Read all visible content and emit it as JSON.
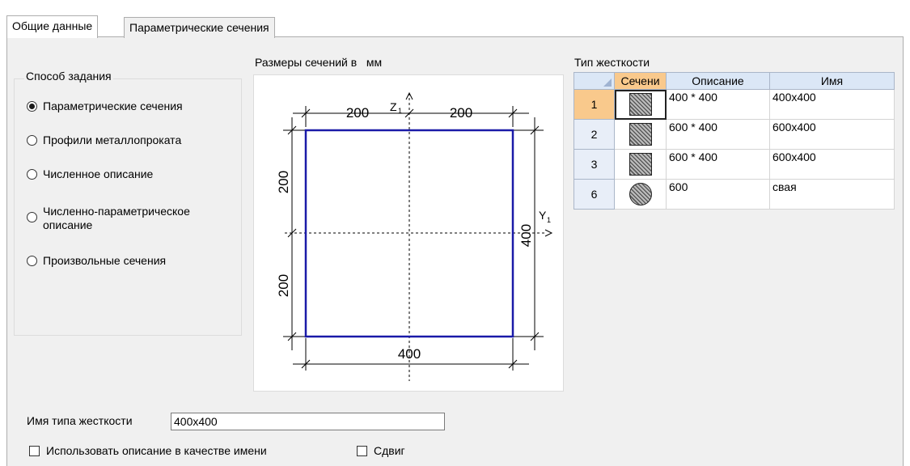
{
  "tabs": [
    {
      "label": "Общие данные",
      "active": true
    },
    {
      "label": "Параметрические сечения",
      "active": false
    }
  ],
  "method_group": {
    "title": "Способ задания",
    "options": [
      {
        "label": "Параметрические сечения",
        "checked": true
      },
      {
        "label": "Профили металлопроката",
        "checked": false
      },
      {
        "label": "Численное описание",
        "checked": false
      },
      {
        "label": "Численно-параметрическое описание",
        "checked": false
      },
      {
        "label": "Произвольные сечения",
        "checked": false
      }
    ]
  },
  "drawing": {
    "title": "Размеры сечений в   мм",
    "dim_top_left": "200",
    "dim_top_right": "200",
    "dim_left_top": "200",
    "dim_left_bottom": "200",
    "dim_right": "400",
    "dim_bottom": "400",
    "axis_z": "Z",
    "axis_y": "Y",
    "axis_subscript": "1",
    "outline_color": "#1a1aa8"
  },
  "grid": {
    "title": "Тип жесткости",
    "columns": [
      "Сечени",
      "Описание",
      "Имя"
    ],
    "rows": [
      {
        "num": "1",
        "shape": "square",
        "description": "400 * 400",
        "name": "400x400",
        "selected": true
      },
      {
        "num": "2",
        "shape": "square",
        "description": "600 * 400",
        "name": "600x400",
        "selected": false
      },
      {
        "num": "3",
        "shape": "square",
        "description": "600 * 400",
        "name": "600x400",
        "selected": false
      },
      {
        "num": "6",
        "shape": "circle",
        "description": "600",
        "name": "свая",
        "selected": false
      }
    ]
  },
  "bottom": {
    "name_label": "Имя типа жесткости",
    "name_value": "400x400",
    "use_description_label": "Использовать описание в качестве имени",
    "use_description_checked": false,
    "shear_label": "Сдвиг",
    "shear_checked": false
  }
}
